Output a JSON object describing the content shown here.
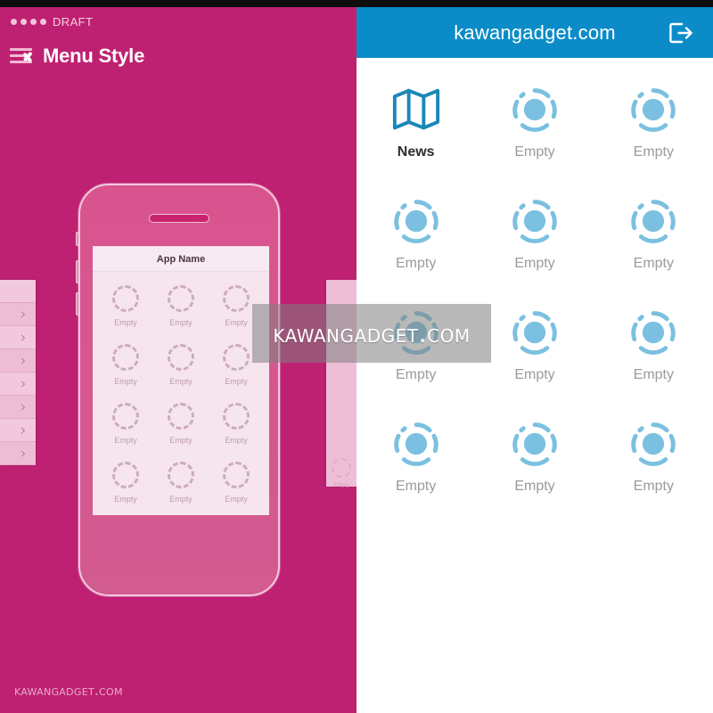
{
  "builder": {
    "status_bar": {
      "dot_count": 4,
      "label": "DRAFT"
    },
    "nav": {
      "menu_icon": "hamburger-back-icon",
      "title": "Menu Style"
    },
    "edge_list": {
      "item_count": 8,
      "chevron_icon": "chevron-right-icon"
    },
    "right_strip": {
      "icon": "empty-placeholder-icon",
      "label": "Empty"
    },
    "phone_preview": {
      "screen_title": "App Name",
      "cells": [
        {
          "label": "Empty",
          "icon": "dashed-ring-icon"
        },
        {
          "label": "Empty",
          "icon": "dashed-ring-icon"
        },
        {
          "label": "Empty",
          "icon": "dashed-ring-icon"
        },
        {
          "label": "Empty",
          "icon": "dashed-ring-icon"
        },
        {
          "label": "Empty",
          "icon": "dashed-ring-icon"
        },
        {
          "label": "Empty",
          "icon": "dashed-ring-icon"
        },
        {
          "label": "Empty",
          "icon": "dashed-ring-icon"
        },
        {
          "label": "Empty",
          "icon": "dashed-ring-icon"
        },
        {
          "label": "Empty",
          "icon": "dashed-ring-icon"
        },
        {
          "label": "Empty",
          "icon": "dashed-ring-icon"
        },
        {
          "label": "Empty",
          "icon": "dashed-ring-icon"
        },
        {
          "label": "Empty",
          "icon": "dashed-ring-icon"
        }
      ]
    },
    "watermark": "kawangadget.com"
  },
  "preview": {
    "header": {
      "title": "kawangadget.com",
      "logout_icon": "logout-icon"
    },
    "menu_items": [
      {
        "label": "News",
        "icon": "map-icon",
        "state": "filled"
      },
      {
        "label": "Empty",
        "icon": "empty-placeholder-icon",
        "state": "empty"
      },
      {
        "label": "Empty",
        "icon": "empty-placeholder-icon",
        "state": "empty"
      },
      {
        "label": "Empty",
        "icon": "empty-placeholder-icon",
        "state": "empty"
      },
      {
        "label": "Empty",
        "icon": "empty-placeholder-icon",
        "state": "empty"
      },
      {
        "label": "Empty",
        "icon": "empty-placeholder-icon",
        "state": "empty"
      },
      {
        "label": "Empty",
        "icon": "empty-placeholder-icon",
        "state": "empty"
      },
      {
        "label": "Empty",
        "icon": "empty-placeholder-icon",
        "state": "empty"
      },
      {
        "label": "Empty",
        "icon": "empty-placeholder-icon",
        "state": "empty"
      },
      {
        "label": "Empty",
        "icon": "empty-placeholder-icon",
        "state": "empty"
      },
      {
        "label": "Empty",
        "icon": "empty-placeholder-icon",
        "state": "empty"
      },
      {
        "label": "Empty",
        "icon": "empty-placeholder-icon",
        "state": "empty"
      }
    ]
  },
  "overlay": {
    "watermark": "kawangadget.com"
  },
  "colors": {
    "builder_pink": "#bf2172",
    "header_blue": "#0b8cc8",
    "icon_blue": "#7bc0e0",
    "news_icon_blue": "#1a87b8",
    "label_gray": "#9b9b9b"
  }
}
